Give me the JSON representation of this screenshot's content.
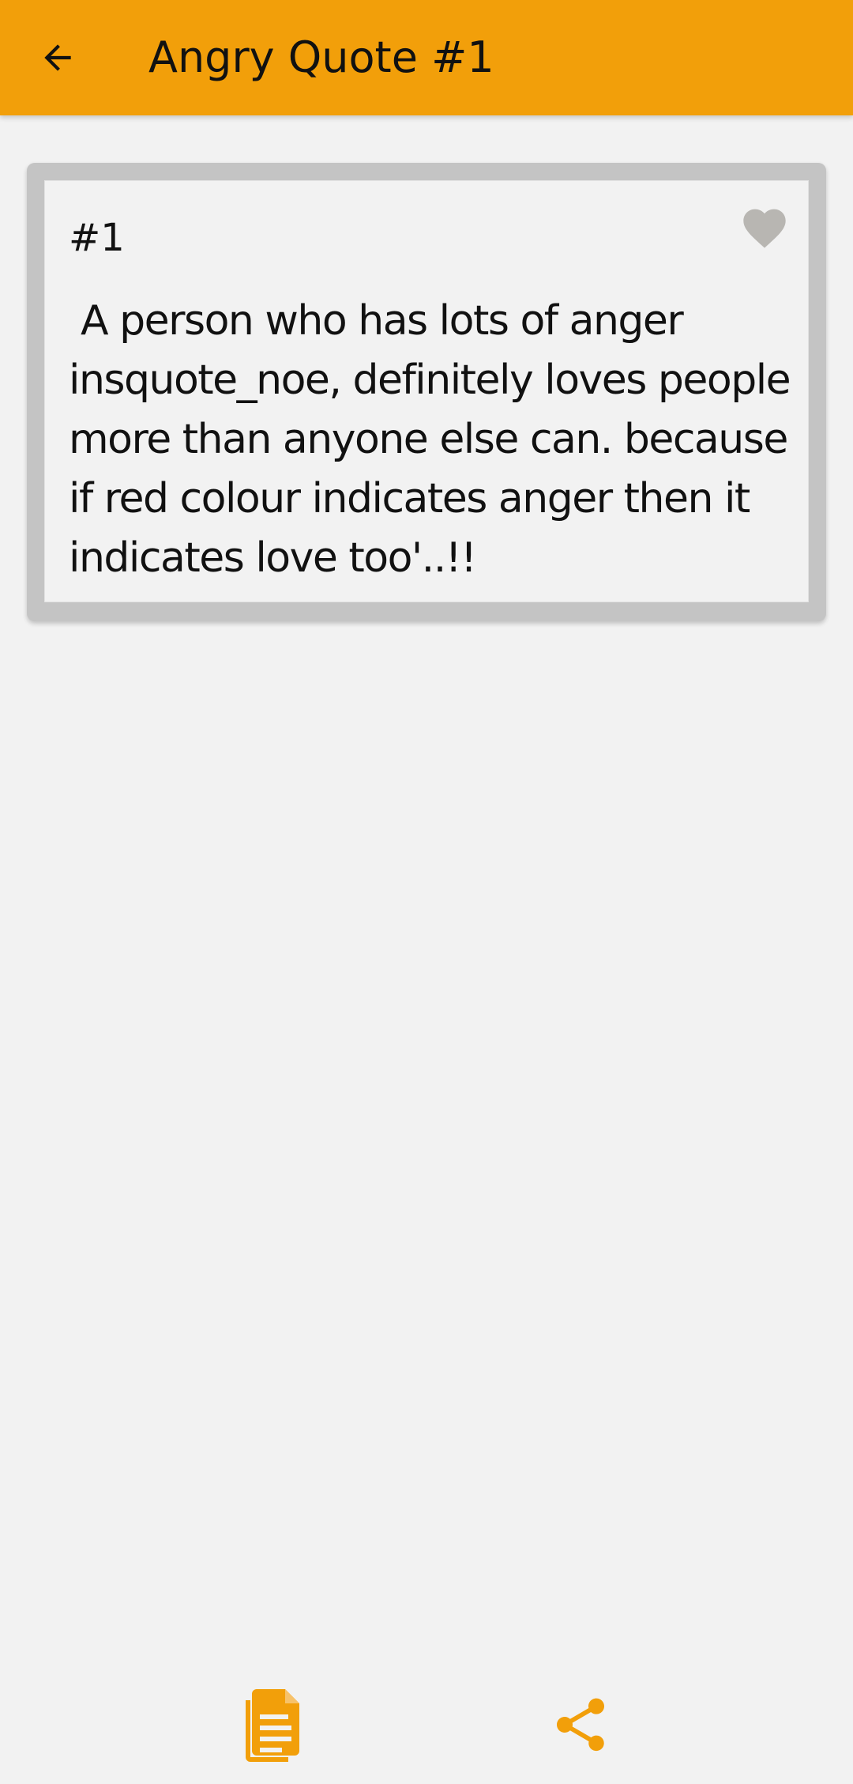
{
  "header": {
    "title": "Angry Quote #1",
    "background_color": "#f29f0a",
    "back_icon": "arrow-back-icon"
  },
  "quote_card": {
    "number": "#1",
    "text": " A person who has lots of anger insquote_noe, definitely loves people more than anyone else can. because if red colour indicates anger then it indicates love too'..!!",
    "favorite_icon": "heart-icon",
    "favorite_color": "#b8b6b2"
  },
  "bottom_bar": {
    "copy_icon": "document-copy-icon",
    "share_icon": "share-icon",
    "accent_color": "#f29f0a"
  }
}
